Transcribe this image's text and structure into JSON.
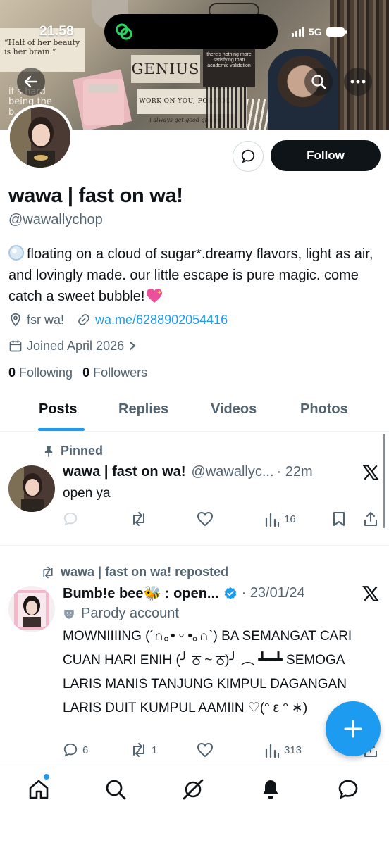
{
  "status_bar": {
    "time": "21.58",
    "network": "5G"
  },
  "banner": {
    "note_quote": "“Half of her beauty is her brain.”",
    "genius_text": "GENIUS",
    "work_text": "WORK ON YOU, FOR YOU.",
    "grades_text": "i always get good grades.",
    "dark_note": "there's nothing more satisfying than academic validation",
    "hard_note": "it's hard being the b..."
  },
  "profile": {
    "display_name": "wawa | fast on wa!",
    "handle": "@wawallychop",
    "bio": "floating on a cloud of sugar*.dreamy flavors, light as air, and lovingly made. our little escape is pure magic. come catch a sweet bubble!",
    "location": "fsr wa!",
    "link": "wa.me/6288902054416",
    "joined": "Joined April 2026",
    "following_count": "0",
    "following_label": "Following",
    "followers_count": "0",
    "followers_label": "Followers",
    "follow_label": "Follow"
  },
  "tabs": [
    "Posts",
    "Replies",
    "Videos",
    "Photos"
  ],
  "tweets": [
    {
      "context": "Pinned",
      "name": "wawa | fast on wa!",
      "handle": "@wawallyc...",
      "time": "· 22m",
      "text": "open ya",
      "replies": "",
      "retweets": "",
      "views": "16"
    },
    {
      "context": "wawa | fast on wa! reposted",
      "name": "Bumb!e bee🐝 : open...",
      "time": "· 23/01/24",
      "parody_label": "Parody account",
      "text": "MOWNIIIING (´∩｡• ᵕ •｡∩`) BA SEMANGAT CARI CUAN HARI ENIH (╯ ਠ ~ ਠ)╯ ︵ ┻━┻ SEMOGA LARIS MANIS TANJUNG KIMPUL DAGANGAN LARIS DUIT KUMPUL AAMIIN ♡(ᵔ ε ᵔ ∗)",
      "replies": "6",
      "retweets": "1",
      "views": "313"
    }
  ],
  "colors": {
    "accent": "#1d9bf0",
    "text": "#0f1419",
    "muted": "#536471",
    "follow_bg": "#0f1419"
  }
}
